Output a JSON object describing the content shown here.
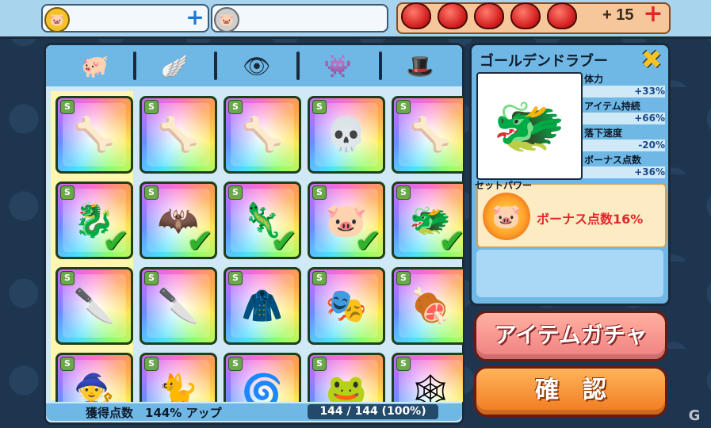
{
  "topbar": {
    "coin_icon": "pig-coin-gold",
    "coin2_icon": "pig-coin-silver",
    "heart_count": "+ 15",
    "hearts": 5,
    "plus_icon": "plus-icon"
  },
  "tabs": [
    {
      "icon": "flying-pig-hat-icon"
    },
    {
      "icon": "wings-icon"
    },
    {
      "icon": "mask-face-icon"
    },
    {
      "icon": "skull-face-icon"
    },
    {
      "icon": "top-hat-icon"
    }
  ],
  "grid": {
    "rows": [
      [
        {
          "badge": "S",
          "icon": "skeleton-pig",
          "glyph": "🦴",
          "equipped": false
        },
        {
          "badge": "S",
          "icon": "bone-wings",
          "glyph": "🦴",
          "equipped": false
        },
        {
          "badge": "S",
          "icon": "skeleton-tail",
          "glyph": "🦴",
          "equipped": false
        },
        {
          "badge": "S",
          "icon": "skull-mask",
          "glyph": "💀",
          "equipped": false
        },
        {
          "badge": "S",
          "icon": "skeleton-bird",
          "glyph": "🦴",
          "equipped": false
        }
      ],
      [
        {
          "badge": "S",
          "icon": "golden-dragon-pig",
          "glyph": "🐉",
          "equipped": true
        },
        {
          "badge": "S",
          "icon": "golden-dragon-wings",
          "glyph": "🦇",
          "equipped": true
        },
        {
          "badge": "S",
          "icon": "golden-dragon-tail",
          "glyph": "🦎",
          "equipped": true
        },
        {
          "badge": "S",
          "icon": "pig-dragon-mouth",
          "glyph": "🐷",
          "equipped": true
        },
        {
          "badge": "S",
          "icon": "golden-dragon-hat",
          "glyph": "🐲",
          "equipped": true
        }
      ],
      [
        {
          "badge": "S",
          "icon": "hockey-mask-pig",
          "glyph": "🔪",
          "equipped": false
        },
        {
          "badge": "S",
          "icon": "machete",
          "glyph": "🔪",
          "equipped": false
        },
        {
          "badge": "S",
          "icon": "torn-cloak",
          "glyph": "🧥",
          "equipped": false
        },
        {
          "badge": "S",
          "icon": "hockey-mask",
          "glyph": "🎭",
          "equipped": false
        },
        {
          "badge": "S",
          "icon": "meat-bone",
          "glyph": "🍖",
          "equipped": false
        }
      ],
      [
        {
          "badge": "S",
          "icon": "witch-pig",
          "glyph": "🧙",
          "equipped": false
        },
        {
          "badge": "S",
          "icon": "black-cat",
          "glyph": "🐈",
          "equipped": false
        },
        {
          "badge": "S",
          "icon": "witch-hat-spiral",
          "glyph": "🌀",
          "equipped": false
        },
        {
          "badge": "S",
          "icon": "frog-face",
          "glyph": "🐸",
          "equipped": false
        },
        {
          "badge": "S",
          "icon": "spider-web-hat",
          "glyph": "🕸",
          "equipped": false
        }
      ]
    ]
  },
  "footer": {
    "label": "獲得点数　144% アップ",
    "count": "144 / 144 (100%)"
  },
  "detail": {
    "title": "ゴールデンドラブー",
    "portrait_glyph": "🐲",
    "stats": [
      {
        "label": "体力",
        "value": "+33%"
      },
      {
        "label": "アイテム持続",
        "value": "+66%"
      },
      {
        "label": "落下速度",
        "value": "-20%"
      },
      {
        "label": "ボーナス点数",
        "value": "+36%"
      }
    ],
    "set_label": "セットパワー",
    "set_glyph": "🐷",
    "set_text": "ボーナス点数16%"
  },
  "buttons": {
    "gacha": "アイテムガチャ",
    "confirm": "確認"
  },
  "watermark": "G"
}
